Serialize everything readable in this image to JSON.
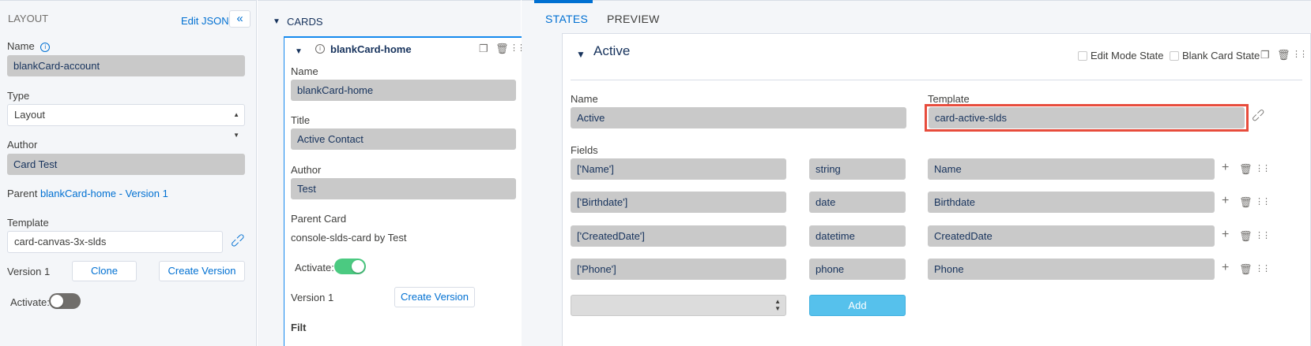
{
  "layout": {
    "section_title": "LAYOUT",
    "edit_json_label": "Edit JSON",
    "collapse_icon": "double-chevron-left-icon",
    "name_label": "Name",
    "name_value": "blankCard-account",
    "type_label": "Type",
    "type_value": "Layout",
    "author_label": "Author",
    "author_value": "Card Test",
    "parent_label": "Parent",
    "parent_link": "blankCard-home - Version 1",
    "template_label": "Template",
    "template_value": "card-canvas-3x-slds",
    "version_label": "Version 1",
    "clone_label": "Clone",
    "create_version_label": "Create Version",
    "activate_label": "Activate:",
    "activate_on": false
  },
  "cards": {
    "section_title": "CARDS",
    "card_title": "blankCard-home",
    "name_label": "Name",
    "name_value": "blankCard-home",
    "title_label": "Title",
    "title_value": "Active Contact",
    "author_label": "Author",
    "author_value": "Test",
    "parent_card_label": "Parent Card",
    "parent_card_value": "console-slds-card by Test",
    "activate_label": "Activate:",
    "activate_on": true,
    "version_label": "Version 1",
    "create_version_label": "Create Version",
    "partial_label": "Filt"
  },
  "tabs": {
    "states": "STATES",
    "preview": "PREVIEW",
    "active_tab": "STATES"
  },
  "state": {
    "title": "Active",
    "edit_mode_label": "Edit Mode State",
    "blank_card_label": "Blank Card State",
    "name_label": "Name",
    "name_value": "Active",
    "template_label": "Template",
    "template_value": "card-active-slds",
    "fields_label": "Fields",
    "fields": [
      {
        "field": "['Name']",
        "type": "string",
        "label": "Name"
      },
      {
        "field": "['Birthdate']",
        "type": "date",
        "label": "Birthdate"
      },
      {
        "field": "['CreatedDate']",
        "type": "datetime",
        "label": "CreatedDate"
      },
      {
        "field": "['Phone']",
        "type": "phone",
        "label": "Phone"
      }
    ],
    "add_label": "Add"
  },
  "colors": {
    "accent": "#0070d2",
    "tab_active": "#0070d2",
    "highlight": "#e74c3c",
    "toggle_on": "#4bca81",
    "toggle_off": "#706e6b",
    "add_button": "#56c1ec"
  }
}
